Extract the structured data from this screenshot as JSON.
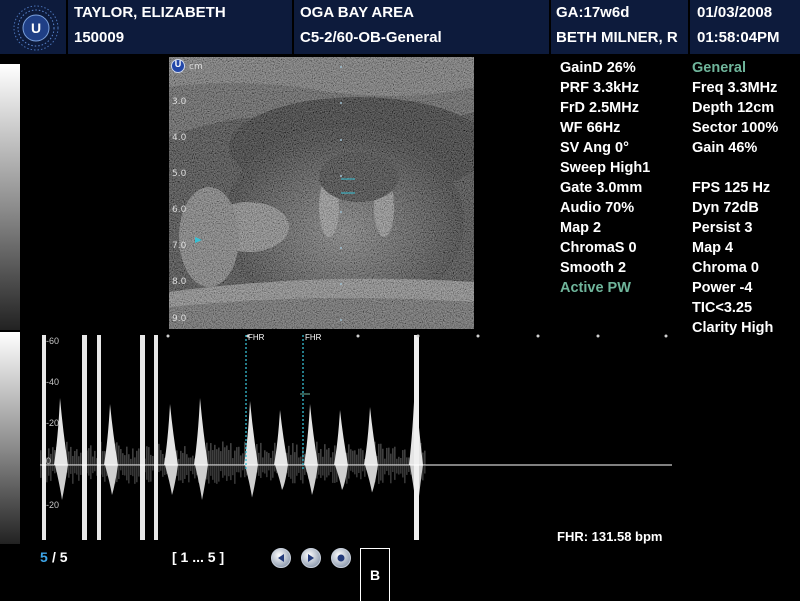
{
  "header": {
    "patient_name": "TAYLOR, ELIZABETH",
    "patient_id": "150009",
    "facility": "OGA BAY AREA",
    "probe_preset": "C5-2/60-OB-General",
    "gestational_age": "GA:17w6d",
    "operator": "BETH MILNER, R",
    "date": "01/03/2008",
    "time": "01:58:04PM"
  },
  "bmode": {
    "depth_unit": "cm",
    "depth_marks": [
      "3.0",
      "4.0",
      "5.0",
      "6.0",
      "7.0",
      "8.0",
      "9.0"
    ]
  },
  "doppler_params": [
    {
      "text": "GainD 26%",
      "active": false
    },
    {
      "text": "PRF 3.3kHz",
      "active": false
    },
    {
      "text": "FrD 2.5MHz",
      "active": false
    },
    {
      "text": "WF 66Hz",
      "active": false
    },
    {
      "text": "SV Ang 0°",
      "active": false
    },
    {
      "text": "Sweep High1",
      "active": false
    },
    {
      "text": "Gate 3.0mm",
      "active": false
    },
    {
      "text": "Audio 70%",
      "active": false
    },
    {
      "text": "Map 2",
      "active": false
    },
    {
      "text": "ChromaS 0",
      "active": false
    },
    {
      "text": "Smooth 2",
      "active": false
    },
    {
      "text": "Active PW",
      "active": true
    }
  ],
  "imaging_params": [
    {
      "text": "General",
      "active": true
    },
    {
      "text": "Freq 3.3MHz",
      "active": false
    },
    {
      "text": "Depth 12cm",
      "active": false
    },
    {
      "text": "Sector 100%",
      "active": false
    },
    {
      "text": "Gain 46%",
      "active": false
    },
    {
      "text": "",
      "active": false
    },
    {
      "text": "FPS 125 Hz",
      "active": false
    },
    {
      "text": "Dyn 72dB",
      "active": false
    },
    {
      "text": "Persist 3",
      "active": false
    },
    {
      "text": "Map 4",
      "active": false
    },
    {
      "text": "Chroma 0",
      "active": false
    },
    {
      "text": "Power -4",
      "active": false
    },
    {
      "text": "TIC<3.25",
      "active": false
    },
    {
      "text": "Clarity High",
      "active": false
    }
  ],
  "doppler": {
    "velocity_labels": [
      "-60",
      "-40",
      "-20",
      "0",
      "-20"
    ],
    "fhr_marker_label": "FHR"
  },
  "measurement": {
    "fhr": "FHR: 131.58 bpm"
  },
  "footer": {
    "frame_current": "5",
    "frame_total": "/ 5",
    "range": "[ 1 ... 5 ]",
    "view_label": "B"
  },
  "colors": {
    "header_bg": "#0d1b3c",
    "active_param": "#6fb59b",
    "fhr_caliper": "#37c0d4",
    "frame_current": "#3da5e8"
  }
}
